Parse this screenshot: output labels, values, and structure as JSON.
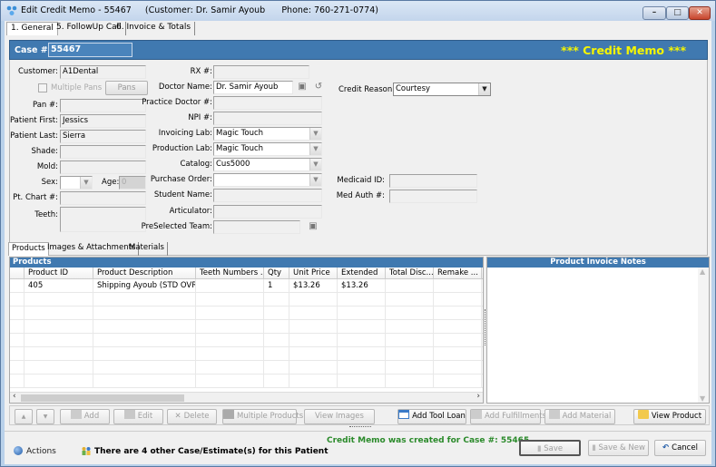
{
  "window": {
    "title": "Edit Credit Memo - 55467     (Customer: Dr. Samir Ayoub      Phone: 760-271-0774)",
    "controls": {
      "minimize": "–",
      "maximize": "□",
      "close": "✕"
    }
  },
  "main_tabs": [
    {
      "label": "1. General",
      "active": true
    },
    {
      "label": "5. FollowUp Call",
      "active": false
    },
    {
      "label": "6. Invoice & Totals",
      "active": false
    }
  ],
  "case_bar": {
    "label": "Case #:",
    "value": "55467",
    "banner": "*** Credit Memo ***",
    "banner_color": "#f6f600",
    "bar_color": "#4079b0"
  },
  "form": {
    "customer": {
      "label": "Customer:",
      "value": "A1Dental"
    },
    "multiple_pans": {
      "label": "Multiple Pans",
      "checked": false
    },
    "pans_button": "Pans",
    "pan_no": {
      "label": "Pan #:",
      "value": ""
    },
    "patient_first": {
      "label": "Patient First:",
      "value": "Jessics"
    },
    "patient_last": {
      "label": "Patient Last:",
      "value": "Sierra"
    },
    "shade": {
      "label": "Shade:",
      "value": ""
    },
    "mold": {
      "label": "Mold:",
      "value": ""
    },
    "sex": {
      "label": "Sex:",
      "value": ""
    },
    "age": {
      "label": "Age:",
      "value": "0"
    },
    "pt_chart": {
      "label": "Pt. Chart #:",
      "value": ""
    },
    "teeth": {
      "label": "Teeth:",
      "value": ""
    },
    "rx_no": {
      "label": "RX #:",
      "value": ""
    },
    "doctor_name": {
      "label": "Doctor Name:",
      "value": "Dr. Samir Ayoub"
    },
    "practice_doctor": {
      "label": "Practice Doctor #:",
      "value": ""
    },
    "npi": {
      "label": "NPI #:",
      "value": ""
    },
    "invoicing_lab": {
      "label": "Invoicing Lab:",
      "value": "Magic Touch"
    },
    "production_lab": {
      "label": "Production Lab:",
      "value": "Magic Touch"
    },
    "catalog": {
      "label": "Catalog:",
      "value": "Cus5000"
    },
    "purchase_order": {
      "label": "Purchase Order:",
      "value": ""
    },
    "student_name": {
      "label": "Student Name:",
      "value": ""
    },
    "articulator": {
      "label": "Articulator:",
      "value": ""
    },
    "preselected_team": {
      "label": "PreSelected Team:",
      "value": ""
    },
    "credit_reason": {
      "label": "Credit Reason:",
      "value": "Courtesy"
    },
    "medicaid_id": {
      "label": "Medicaid ID:",
      "value": ""
    },
    "med_auth": {
      "label": "Med Auth #:",
      "value": ""
    }
  },
  "sub_tabs": [
    {
      "label": "Products",
      "active": true
    },
    {
      "label": "Images & Attachments",
      "active": false
    },
    {
      "label": "Materials",
      "active": false
    }
  ],
  "products": {
    "title": "Products",
    "columns": [
      "Product ID",
      "Product Description",
      "Teeth Numbers ...",
      "Qty",
      "Unit Price",
      "Extended",
      "Total Disc...",
      "Remake ..."
    ],
    "rows": [
      [
        "405",
        "Shipping Ayoub (STD OVR...",
        "",
        "1",
        "$13.26",
        "$13.26",
        "",
        ""
      ]
    ]
  },
  "notes": {
    "title": "Product Invoice Notes",
    "value": ""
  },
  "toolbar": {
    "up": "▲",
    "down": "▼",
    "add": "Add",
    "edit": "Edit",
    "delete": "Delete",
    "multiple_products": "Multiple Products",
    "view_images": "View Images",
    "add_tool_loan": "Add Tool Loan",
    "add_fulfillments": "Add Fulfillments",
    "add_material": "Add Material",
    "view_product": "View Product"
  },
  "status": {
    "actions": "Actions",
    "other_cases": "There are 4 other Case/Estimate(s) for this Patient",
    "created_message": "Credit Memo was created for Case #: 55465",
    "message_color": "#2a8a2a"
  },
  "footer_buttons": {
    "save": "Save",
    "save_new": "Save & New",
    "cancel": "Cancel"
  }
}
